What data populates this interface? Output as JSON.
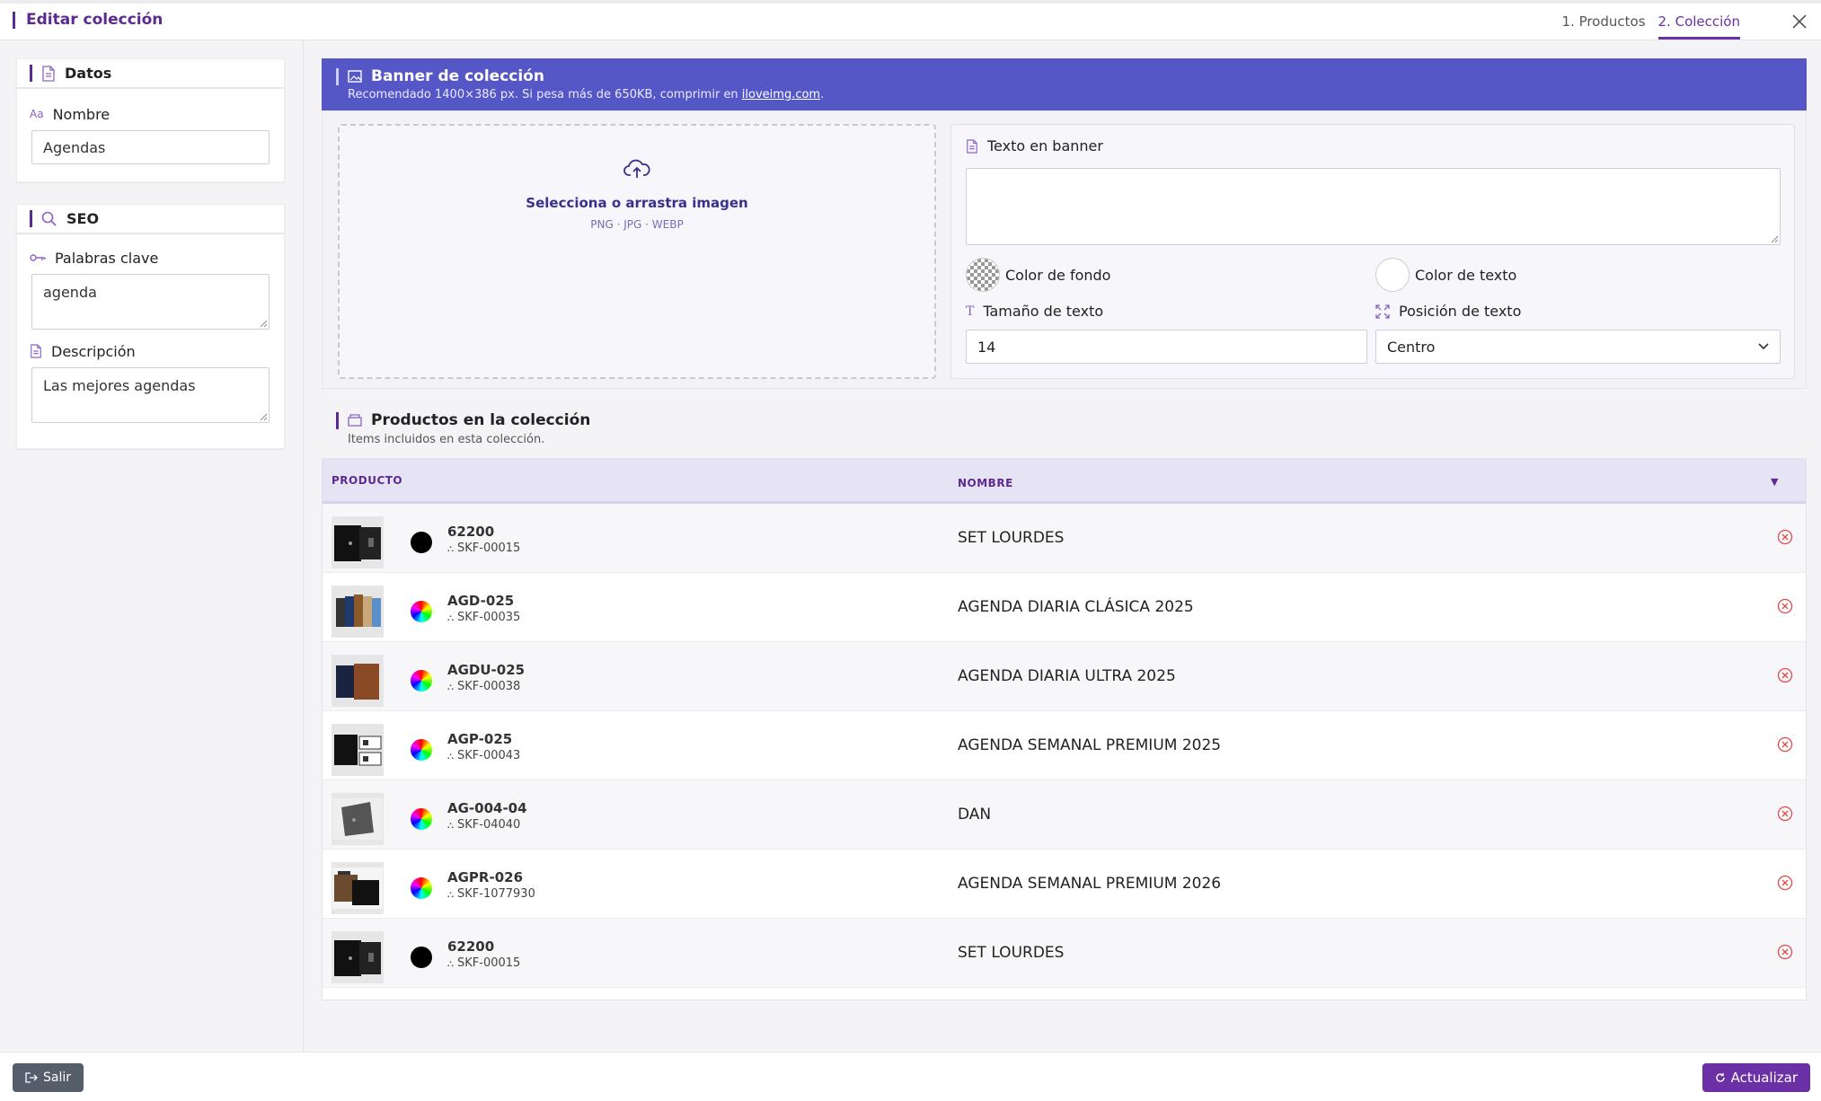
{
  "header": {
    "title": "Editar colección",
    "steps": [
      "1. Productos",
      "2. Colección"
    ],
    "active_step": 1
  },
  "sidebar": {
    "datos": {
      "title": "Datos",
      "nombre_label": "Nombre",
      "nombre_value": "Agendas"
    },
    "seo": {
      "title": "SEO",
      "keywords_label": "Palabras clave",
      "keywords_value": "agenda",
      "description_label": "Descripción",
      "description_value": "Las mejores agendas"
    }
  },
  "banner": {
    "title": "Banner de colección",
    "subtitle_prefix": "Recomendado 1400×386 px. Si pesa más de 650KB, comprimir en",
    "subtitle_link": "iloveimg.com",
    "subtitle_suffix": ".",
    "upload_label": "Selecciona o arrastra imagen",
    "upload_formats": "PNG · JPG · WEBP",
    "text_label": "Texto en banner",
    "text_value": "",
    "bg_color_label": "Color de fondo",
    "text_color_label": "Color de texto",
    "size_label": "Tamaño de texto",
    "size_value": "14",
    "position_label": "Posición de texto",
    "position_value": "Centro"
  },
  "products": {
    "title": "Productos en la colección",
    "subtitle": "Items incluidos en esta colección.",
    "col_product": "PRODUCTO",
    "col_name": "NOMBRE",
    "rows": [
      {
        "code": "62200",
        "sku": "SKF-00015",
        "name": "SET LOURDES",
        "color": "black"
      },
      {
        "code": "AGD-025",
        "sku": "SKF-00035",
        "name": "AGENDA DIARIA CLÁSICA 2025",
        "color": "multi"
      },
      {
        "code": "AGDU-025",
        "sku": "SKF-00038",
        "name": "AGENDA DIARIA ULTRA 2025",
        "color": "multi"
      },
      {
        "code": "AGP-025",
        "sku": "SKF-00043",
        "name": "AGENDA SEMANAL PREMIUM 2025",
        "color": "multi"
      },
      {
        "code": "AG-004-04",
        "sku": "SKF-04040",
        "name": "DAN",
        "color": "multi"
      },
      {
        "code": "AGPR-026",
        "sku": "SKF-1077930",
        "name": "AGENDA SEMANAL PREMIUM 2026",
        "color": "multi"
      },
      {
        "code": "62200",
        "sku": "SKF-00015",
        "name": "SET LOURDES",
        "color": "black"
      }
    ]
  },
  "footer": {
    "exit_label": "Salir",
    "update_label": "Actualizar"
  },
  "colors": {
    "accent": "#6b2fa6",
    "banner": "#5557c6"
  }
}
